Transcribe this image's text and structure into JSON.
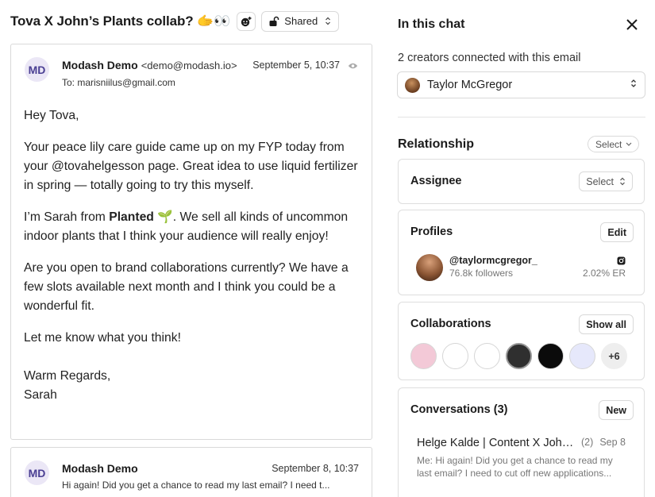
{
  "thread": {
    "title": "Tova X John’s Plants collab? 🫱👀",
    "shared_label": "Shared"
  },
  "email1": {
    "avatar_initials": "MD",
    "sender_name": "Modash Demo",
    "sender_email": "<demo@modash.io>",
    "date": "September 5, 10:37",
    "to": "To: marisniilus@gmail.com",
    "greeting": "Hey Tova,",
    "p1": "Your peace lily care guide came up on my FYP today from your @tovahelgesson page. Great idea to use liquid fertilizer in spring — totally going to try this myself.",
    "p2_before": "I’m Sarah from ",
    "p2_bold": "Planted",
    "p2_after": " 🌱. We sell all kinds of uncommon indoor plants that I think your audience will really enjoy!",
    "p3": "Are you open to brand collaborations currently? We have a few slots available next month and I think you could be a wonderful fit.",
    "p4": "Let me know what you think!",
    "signoff": "Warm Regards,",
    "signature": "Sarah"
  },
  "email2": {
    "avatar_initials": "MD",
    "sender_name": "Modash Demo",
    "date": "September 8, 10:37",
    "preview": "Hi again! Did you get a chance to read my last email? I need t..."
  },
  "panel": {
    "title": "In this chat",
    "creators_count": "2 creators connected with this email",
    "selected_creator": "Taylor McGregor",
    "relationship_title": "Relationship",
    "relationship_select": "Select",
    "assignee_label": "Assignee",
    "assignee_select": "Select",
    "profiles_label": "Profiles",
    "profiles_edit": "Edit",
    "profile_handle": "@taylormcgregor_",
    "profile_followers": "76.8k followers",
    "profile_er": "2.02% ER",
    "collabs_label": "Collaborations",
    "collabs_show_all": "Show all",
    "collabs_more": "+6",
    "convos_label": "Conversations (3)",
    "convos_new": "New",
    "conv_name": "Helge Kalde | Content X John’s Plants",
    "conv_count": "(2)",
    "conv_date": "Sep 8",
    "conv_preview_1": "Me: Hi again! Did you get a chance to read my",
    "conv_preview_2": "last email? I need to cut off new applications..."
  },
  "colors": {
    "avatar_bg": "#ebe7f6",
    "avatar_text": "#4a3f93",
    "border": "#d9d9d9"
  }
}
